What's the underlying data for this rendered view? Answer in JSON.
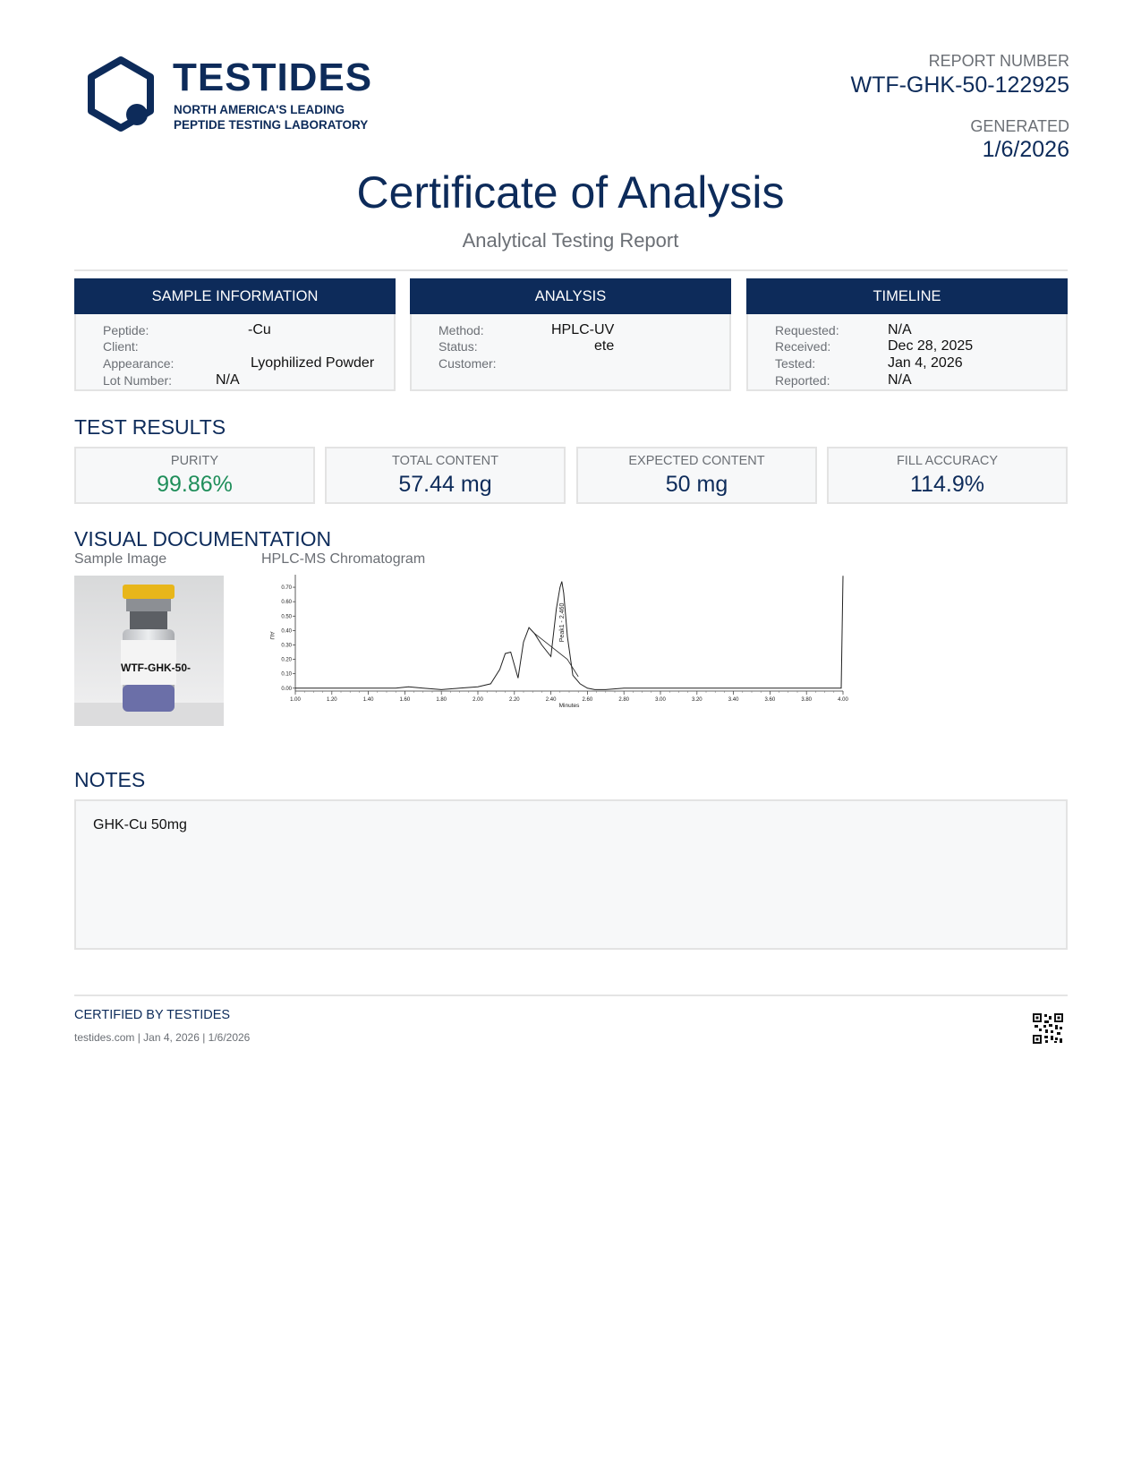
{
  "header": {
    "brand_name": "TESTIDES",
    "tagline_line1": "NORTH AMERICA'S LEADING",
    "tagline_line2": "PEPTIDE TESTING LABORATORY",
    "report_number_label": "REPORT NUMBER",
    "report_number": "WTF-GHK-50-122925",
    "generated_label": "GENERATED",
    "generated": "1/6/2026"
  },
  "title": "Certificate of Analysis",
  "subtitle": "Analytical Testing Report",
  "sample_information": {
    "heading": "SAMPLE INFORMATION",
    "peptide_label": "Peptide:",
    "peptide": "-Cu",
    "client_label": "Client:",
    "client": "",
    "appearance_label": "Appearance:",
    "appearance": "Lyophilized Powder",
    "lot_label": "Lot Number:",
    "lot": "N/A"
  },
  "analysis": {
    "heading": "ANALYSIS",
    "method_label": "Method:",
    "method": "HPLC-UV",
    "status_label": "Status:",
    "status": "ete",
    "customer_label": "Customer:",
    "customer": ""
  },
  "timeline": {
    "heading": "TIMELINE",
    "requested_label": "Requested:",
    "requested": "N/A",
    "received_label": "Received:",
    "received": "Dec 28, 2025",
    "tested_label": "Tested:",
    "tested": "Jan 4, 2026",
    "reported_label": "Reported:",
    "reported": "N/A"
  },
  "test_results": {
    "heading": "TEST RESULTS",
    "purity_label": "PURITY",
    "purity": "99.86%",
    "total_label": "TOTAL CONTENT",
    "total": "57.44 mg",
    "expected_label": "EXPECTED CONTENT",
    "expected": "50 mg",
    "fill_label": "FILL ACCURACY",
    "fill": "114.9%"
  },
  "visual": {
    "heading": "VISUAL DOCUMENTATION",
    "sample_image_label": "Sample Image",
    "chromatogram_label": "HPLC-MS Chromatogram",
    "vial_label_text": "WTF-GHK-50-"
  },
  "chart_data": {
    "type": "line",
    "xlabel": "Minutes",
    "ylabel": "AU",
    "xlim": [
      1.0,
      4.0
    ],
    "ylim": [
      -0.02,
      0.75
    ],
    "x_ticks": [
      "1.00",
      "1.20",
      "1.40",
      "1.60",
      "1.80",
      "2.00",
      "2.20",
      "2.40",
      "2.60",
      "2.80",
      "3.00",
      "3.20",
      "3.40",
      "3.60",
      "3.80",
      "4.00"
    ],
    "y_ticks": [
      "0.00",
      "0.10",
      "0.20",
      "0.30",
      "0.40",
      "0.50",
      "0.60",
      "0.70"
    ],
    "peak_label": "Peak1 - 2.460",
    "series": [
      {
        "x": [
          1.0,
          1.55,
          1.62,
          1.7,
          1.8,
          1.9,
          2.0,
          2.07,
          2.12,
          2.15,
          2.18,
          2.22,
          2.25,
          2.28,
          2.31,
          2.35,
          2.4,
          2.43,
          2.45,
          2.46,
          2.47,
          2.49,
          2.52,
          2.56,
          2.6,
          2.64,
          2.7,
          2.8,
          2.9,
          3.0,
          3.5,
          3.99,
          4.0
        ],
        "y": [
          0.0,
          0.0,
          0.01,
          0.0,
          -0.01,
          0.0,
          0.01,
          0.03,
          0.13,
          0.24,
          0.25,
          0.07,
          0.32,
          0.42,
          0.38,
          0.3,
          0.22,
          0.55,
          0.7,
          0.74,
          0.66,
          0.36,
          0.09,
          0.03,
          0.0,
          -0.01,
          -0.01,
          0.0,
          0.0,
          0.0,
          0.0,
          0.0,
          0.78
        ]
      }
    ]
  },
  "notes": {
    "heading": "NOTES",
    "text": "GHK-Cu 50mg"
  },
  "footer": {
    "certified": "CERTIFIED BY TESTIDES",
    "line": "testides.com | Jan 4, 2026 | 1/6/2026"
  },
  "colors": {
    "brand_navy": "#0d2b5a",
    "purity_green": "#1f8e5a",
    "panel_bg": "#f7f8f9"
  }
}
